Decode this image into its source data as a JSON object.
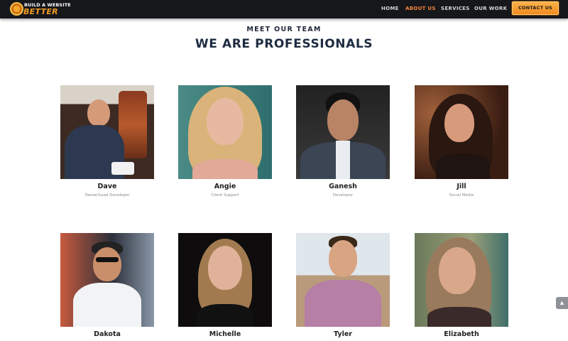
{
  "header": {
    "logo_line1": "BUILD A WEBSITE",
    "logo_line2": "BETTER",
    "nav": [
      {
        "label": "HOME",
        "active": false
      },
      {
        "label": "ABOUT US",
        "active": true
      },
      {
        "label": "SERVICES",
        "active": false
      },
      {
        "label": "OUR WORK",
        "active": false
      }
    ],
    "contact_label": "CONTACT US"
  },
  "section": {
    "subtitle": "MEET OUR TEAM",
    "title": "WE ARE PROFESSIONALS"
  },
  "team": [
    {
      "name": "Dave",
      "role": "Owner/Lead Developer"
    },
    {
      "name": "Angie",
      "role": "Client Support"
    },
    {
      "name": "Ganesh",
      "role": "Developer"
    },
    {
      "name": "Jill",
      "role": "Social Media"
    },
    {
      "name": "Dakota",
      "role": ""
    },
    {
      "name": "Michelle",
      "role": ""
    },
    {
      "name": "Tyler",
      "role": ""
    },
    {
      "name": "Elizabeth",
      "role": ""
    }
  ],
  "colors": {
    "header_bg": "#16171b",
    "accent": "#f5843a",
    "title": "#1e2c42"
  },
  "icons": {
    "scroll_top": "chevron-up-icon"
  }
}
